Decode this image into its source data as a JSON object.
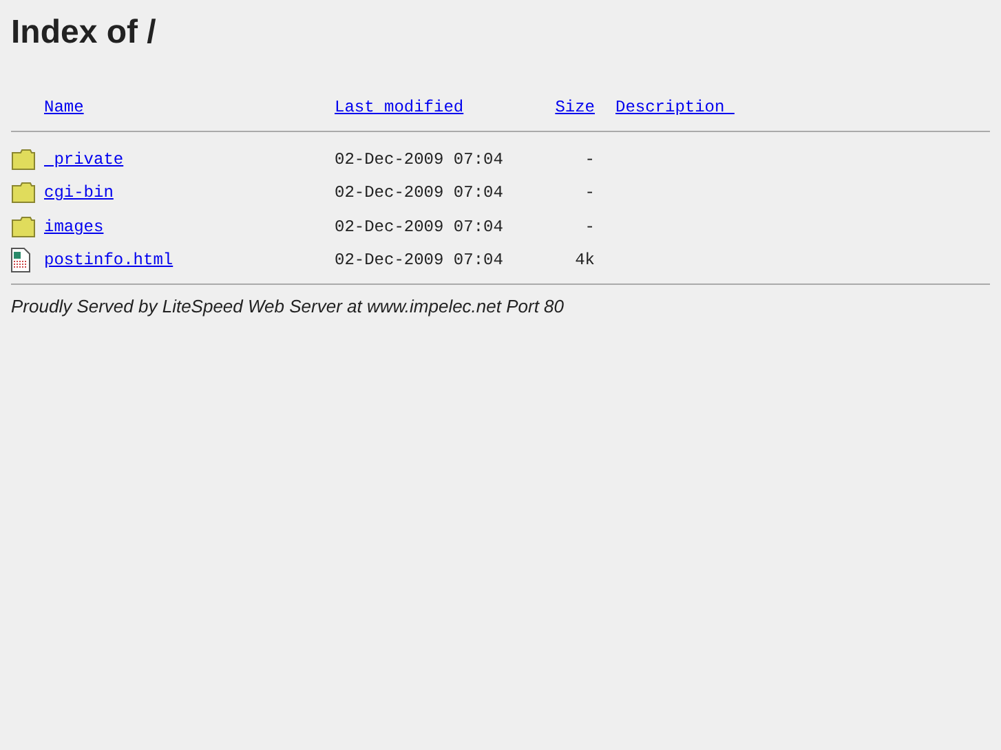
{
  "title": "Index of /",
  "columns": [
    {
      "label": "Name"
    },
    {
      "label": "Last modified"
    },
    {
      "label": "Size"
    },
    {
      "label": "Description "
    }
  ],
  "rows": [
    {
      "kind": "folder",
      "name": " private",
      "modified": "02-Dec-2009 07:04",
      "size": "-"
    },
    {
      "kind": "folder",
      "name": "cgi-bin",
      "modified": "02-Dec-2009 07:04",
      "size": "-"
    },
    {
      "kind": "folder",
      "name": "images",
      "modified": "02-Dec-2009 07:04",
      "size": "-"
    },
    {
      "kind": "file",
      "name": "postinfo.html",
      "modified": "02-Dec-2009 07:04",
      "size": "4k"
    }
  ],
  "footer": "Proudly Served by LiteSpeed Web Server at www.impelec.net Port 80"
}
